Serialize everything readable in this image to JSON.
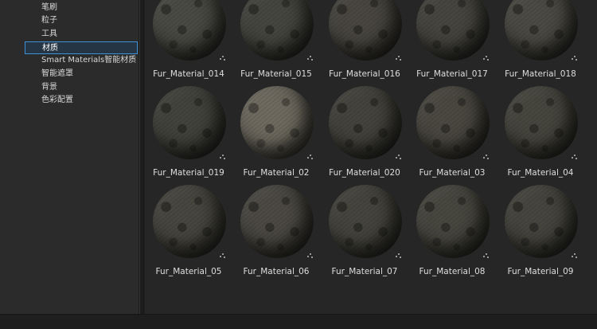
{
  "sidebar": {
    "items": [
      {
        "label": "笔刷"
      },
      {
        "label": "粒子"
      },
      {
        "label": "工具"
      },
      {
        "label": "材质",
        "selected": true
      },
      {
        "label": "Smart Materials智能材质"
      },
      {
        "label": "智能遮罩"
      },
      {
        "label": "背景"
      },
      {
        "label": "色彩配置"
      }
    ]
  },
  "materials": {
    "rows": [
      [
        {
          "name": "Fur_Material_014",
          "color": "#4a4a44"
        },
        {
          "name": "Fur_Material_015",
          "color": "#464640"
        },
        {
          "name": "Fur_Material_016",
          "color": "#48463f"
        },
        {
          "name": "Fur_Material_017",
          "color": "#46453f"
        },
        {
          "name": "Fur_Material_018",
          "color": "#4b4a43"
        }
      ],
      [
        {
          "name": "Fur_Material_019",
          "color": "#43433d"
        },
        {
          "name": "Fur_Material_02",
          "color": "#6e6a5f"
        },
        {
          "name": "Fur_Material_020",
          "color": "#44433c"
        },
        {
          "name": "Fur_Material_03",
          "color": "#4a4840"
        },
        {
          "name": "Fur_Material_04",
          "color": "#47463e"
        }
      ],
      [
        {
          "name": "Fur_Material_05",
          "color": "#47463f"
        },
        {
          "name": "Fur_Material_06",
          "color": "#4b4942"
        },
        {
          "name": "Fur_Material_07",
          "color": "#45443d"
        },
        {
          "name": "Fur_Material_08",
          "color": "#48473f"
        },
        {
          "name": "Fur_Material_09",
          "color": "#46453e"
        }
      ]
    ]
  }
}
